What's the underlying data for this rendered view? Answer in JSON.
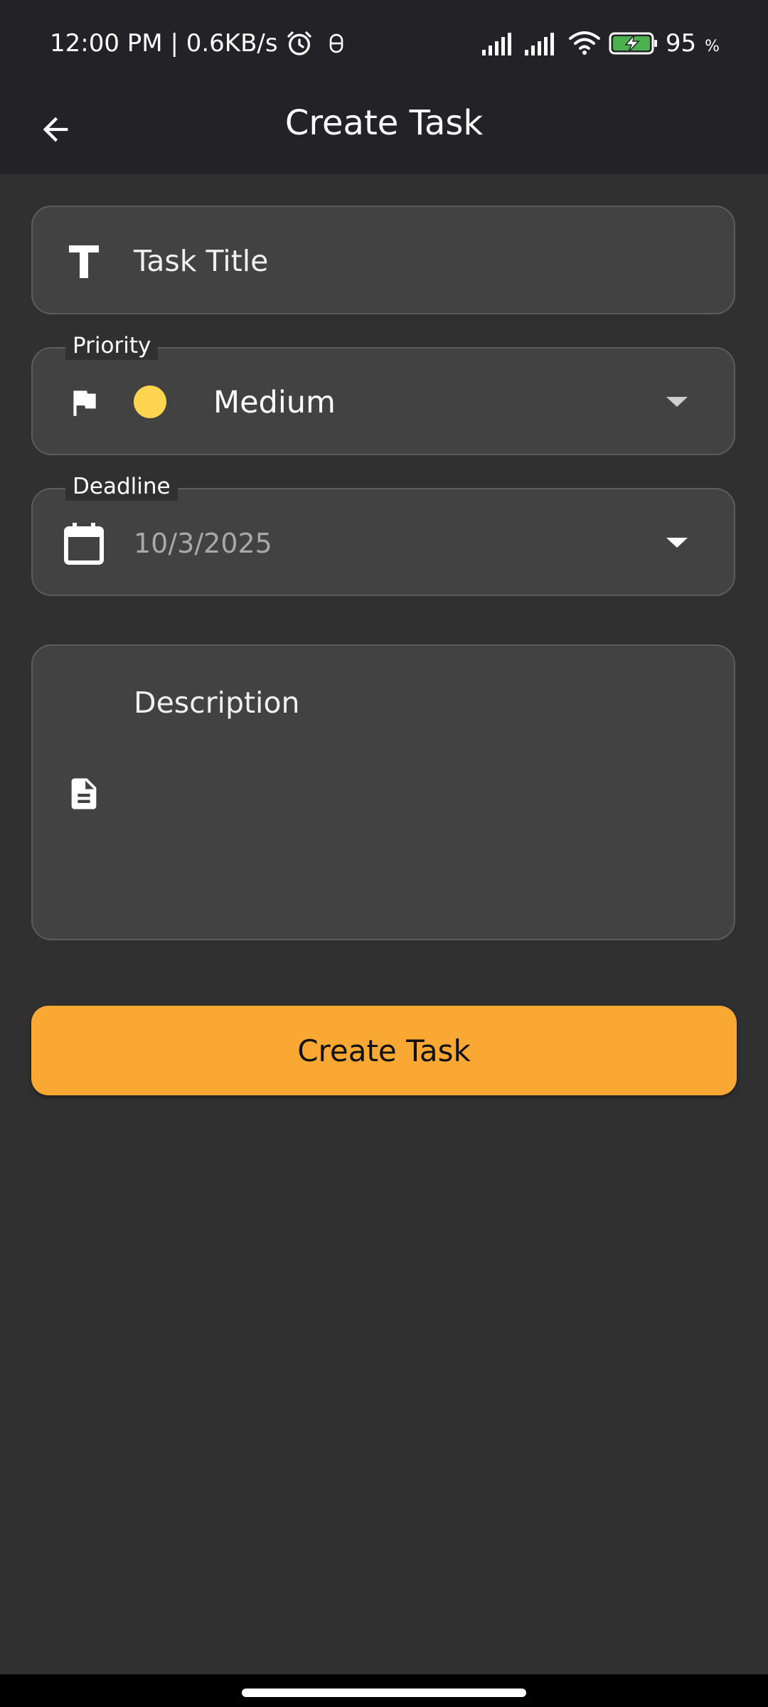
{
  "status_bar": {
    "time": "12:00 PM",
    "separator": " | ",
    "network_speed": "0.6KB/s",
    "battery_level": "95",
    "battery_unit": "%",
    "icons": [
      "alarm-icon",
      "notification-icon",
      "signal-icon",
      "signal-icon",
      "wifi-icon",
      "battery-charging-icon"
    ]
  },
  "app_bar": {
    "title": "Create Task",
    "back_icon": "arrow-back-icon"
  },
  "form": {
    "title_field": {
      "placeholder": "Task Title",
      "icon": "title-icon"
    },
    "priority_field": {
      "label": "Priority",
      "selected": "Medium",
      "indicator_color": "#ffd54f",
      "icon": "flag-icon"
    },
    "deadline_field": {
      "label": "Deadline",
      "value": "10/3/2025",
      "icon": "calendar-icon"
    },
    "description_field": {
      "placeholder": "Description",
      "icon": "document-icon"
    }
  },
  "submit_button": {
    "label": "Create Task",
    "color": "#f9a933"
  },
  "colors": {
    "background": "#303030",
    "app_bar": "#222227",
    "field_fill": "#424242",
    "field_border": "#5c5c5c",
    "accent": "#f9a933"
  }
}
